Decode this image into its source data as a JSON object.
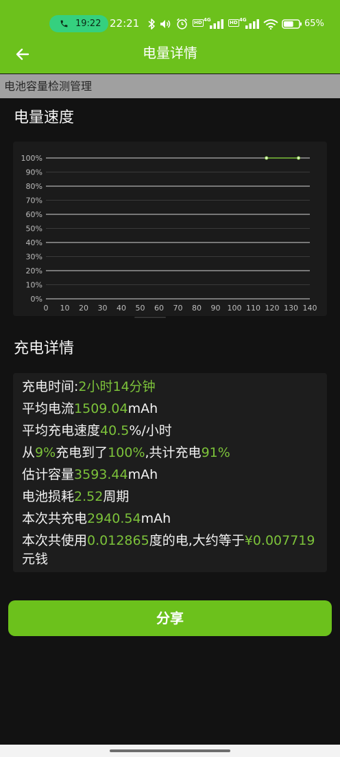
{
  "colors": {
    "primary_green": "#6cc11c",
    "value_green": "#7cc23a",
    "call_pill_green": "#35d07f",
    "page_background": "#121212",
    "card_background": "#1c1c1c",
    "subheader_background": "#a0a0a0"
  },
  "status_bar": {
    "call_timer": "19:22",
    "clock": "22:21",
    "sim1_hd_badge": "HD",
    "sim1_network": "4G",
    "sim2_hd_badge": "HD",
    "sim2_network": "4G",
    "battery_percent_text": "65%",
    "battery_level": 0.65,
    "icons": [
      "phone-icon",
      "bluetooth-icon",
      "volume-icon",
      "alarm-icon",
      "signal-icon",
      "wifi-icon",
      "battery-icon"
    ]
  },
  "app_bar": {
    "back_icon": "back-arrow-icon",
    "title": "电量详情"
  },
  "subheader": {
    "text": "电池容量检测管理"
  },
  "speed_section": {
    "title": "电量速度"
  },
  "chart_data": {
    "type": "line",
    "title": "",
    "xlabel": "",
    "ylabel": "",
    "xlim": [
      0,
      140
    ],
    "ylim": [
      0,
      100
    ],
    "xticks": [
      "0",
      "10",
      "20",
      "30",
      "40",
      "50",
      "60",
      "70",
      "80",
      "90",
      "100",
      "110",
      "120",
      "130",
      "140"
    ],
    "yticks": [
      "0%",
      "10%",
      "20%",
      "30%",
      "40%",
      "50%",
      "60%",
      "70%",
      "80%",
      "90%",
      "100%"
    ],
    "grid": true,
    "legend": "none",
    "series": [
      {
        "x": [
          117,
          134
        ],
        "y": [
          100,
          100
        ],
        "color": "#7cc23a"
      }
    ]
  },
  "details_section": {
    "title": "充电详情",
    "lines": [
      {
        "segments": [
          {
            "text": "充电时间:",
            "highlight": false
          },
          {
            "text": "2小时14分钟",
            "highlight": true
          }
        ]
      },
      {
        "segments": [
          {
            "text": "平均电流",
            "highlight": false
          },
          {
            "text": "1509.04",
            "highlight": true
          },
          {
            "text": "mAh",
            "highlight": false
          }
        ]
      },
      {
        "segments": [
          {
            "text": "平均充电速度",
            "highlight": false
          },
          {
            "text": "40.5",
            "highlight": true
          },
          {
            "text": "%/小时",
            "highlight": false
          }
        ]
      },
      {
        "segments": [
          {
            "text": "从",
            "highlight": false
          },
          {
            "text": "9%",
            "highlight": true
          },
          {
            "text": "充电到了",
            "highlight": false
          },
          {
            "text": "100%",
            "highlight": true
          },
          {
            "text": ",共计充电",
            "highlight": false
          },
          {
            "text": "91%",
            "highlight": true
          }
        ]
      },
      {
        "segments": [
          {
            "text": "估计容量",
            "highlight": false
          },
          {
            "text": "3593.44",
            "highlight": true
          },
          {
            "text": "mAh",
            "highlight": false
          }
        ]
      },
      {
        "segments": [
          {
            "text": "电池损耗",
            "highlight": false
          },
          {
            "text": "2.52",
            "highlight": true
          },
          {
            "text": "周期",
            "highlight": false
          }
        ]
      },
      {
        "segments": [
          {
            "text": "本次共充电",
            "highlight": false
          },
          {
            "text": "2940.54",
            "highlight": true
          },
          {
            "text": "mAh",
            "highlight": false
          }
        ]
      },
      {
        "segments": [
          {
            "text": "本次共使用",
            "highlight": false
          },
          {
            "text": "0.012865",
            "highlight": true
          },
          {
            "text": "度的电,大约等于",
            "highlight": false
          },
          {
            "text": "¥0.007719",
            "highlight": true
          },
          {
            "text": "元钱",
            "highlight": false
          }
        ]
      }
    ]
  },
  "share_button": {
    "label": "分享"
  }
}
